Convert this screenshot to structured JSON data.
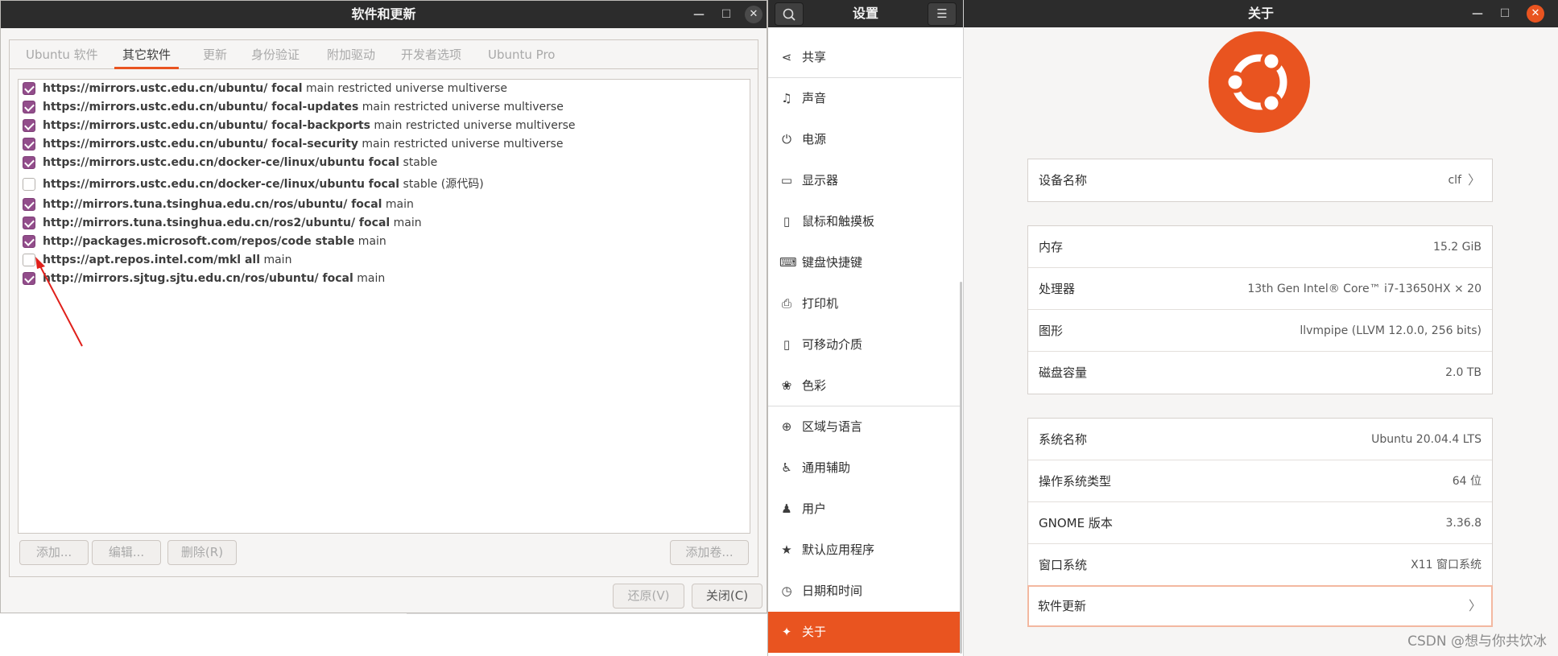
{
  "sw_window": {
    "title": "软件和更新",
    "minimize_icon": "—",
    "maximize_icon": "☐",
    "close_icon": "✕",
    "tabs": [
      "Ubuntu 软件",
      "其它软件",
      "更新",
      "身份验证",
      "附加驱动",
      "开发者选项",
      "Ubuntu Pro"
    ],
    "active_tab": "其它软件",
    "sources": [
      {
        "checked": true,
        "bold": "https://mirrors.ustc.edu.cn/ubuntu/ focal",
        "rest": " main restricted universe multiverse"
      },
      {
        "checked": true,
        "bold": "https://mirrors.ustc.edu.cn/ubuntu/ focal-updates",
        "rest": " main restricted universe multiverse"
      },
      {
        "checked": true,
        "bold": "https://mirrors.ustc.edu.cn/ubuntu/ focal-backports",
        "rest": " main restricted universe multiverse"
      },
      {
        "checked": true,
        "bold": "https://mirrors.ustc.edu.cn/ubuntu/ focal-security",
        "rest": " main restricted universe multiverse"
      },
      {
        "checked": true,
        "bold": "https://mirrors.ustc.edu.cn/docker-ce/linux/ubuntu focal",
        "rest": " stable"
      },
      {
        "checked": false,
        "bold": "https://mirrors.ustc.edu.cn/docker-ce/linux/ubuntu focal",
        "rest": " stable (源代码)"
      },
      {
        "checked": true,
        "bold": "http://mirrors.tuna.tsinghua.edu.cn/ros/ubuntu/ focal",
        "rest": " main"
      },
      {
        "checked": true,
        "bold": "http://mirrors.tuna.tsinghua.edu.cn/ros2/ubuntu/ focal",
        "rest": " main"
      },
      {
        "checked": true,
        "bold": "http://packages.microsoft.com/repos/code stable",
        "rest": " main"
      },
      {
        "checked": false,
        "bold": "https://apt.repos.intel.com/mkl all",
        "rest": " main"
      },
      {
        "checked": true,
        "bold": "http://mirrors.sjtug.sjtu.edu.cn/ros/ubuntu/ focal",
        "rest": " main"
      }
    ],
    "buttons": {
      "add": "添加...",
      "edit": "编辑...",
      "remove": "删除(R)",
      "add_volume": "添加卷..."
    },
    "footer": {
      "revert": "还原(V)",
      "close": "关闭(C)"
    }
  },
  "settings": {
    "title": "设置",
    "search_icon": "search-icon",
    "menu_icon": "☰",
    "items": [
      {
        "label": "共享",
        "icon": "share-icon",
        "glyph": "⋖"
      },
      {
        "label": "声音",
        "icon": "music-note-icon",
        "glyph": "♫"
      },
      {
        "label": "电源",
        "icon": "power-icon",
        "glyph": "⏻"
      },
      {
        "label": "显示器",
        "icon": "display-icon",
        "glyph": "▭"
      },
      {
        "label": "鼠标和触摸板",
        "icon": "mouse-icon",
        "glyph": "▯"
      },
      {
        "label": "键盘快捷键",
        "icon": "keyboard-icon",
        "glyph": "⌨"
      },
      {
        "label": "打印机",
        "icon": "printer-icon",
        "glyph": "⎙"
      },
      {
        "label": "可移动介质",
        "icon": "removable-media-icon",
        "glyph": "▯"
      },
      {
        "label": "色彩",
        "icon": "color-icon",
        "glyph": "❀"
      },
      {
        "label": "区域与语言",
        "icon": "globe-icon",
        "glyph": "⊕"
      },
      {
        "label": "通用辅助",
        "icon": "accessibility-icon",
        "glyph": "♿"
      },
      {
        "label": "用户",
        "icon": "users-icon",
        "glyph": "♟"
      },
      {
        "label": "默认应用程序",
        "icon": "star-icon",
        "glyph": "★"
      },
      {
        "label": "日期和时间",
        "icon": "clock-icon",
        "glyph": "◷"
      },
      {
        "label": "关于",
        "icon": "sparkle-icon",
        "glyph": "✦"
      }
    ]
  },
  "about": {
    "title": "关于",
    "minimize_icon": "—",
    "maximize_icon": "☐",
    "close_icon": "✕",
    "device_name_label": "设备名称",
    "device_name_value": "clf",
    "hardware": [
      {
        "k": "内存",
        "v": "15.2 GiB"
      },
      {
        "k": "处理器",
        "v": "13th Gen Intel® Core™ i7-13650HX × 20"
      },
      {
        "k": "图形",
        "v": "llvmpipe (LLVM 12.0.0, 256 bits)"
      },
      {
        "k": "磁盘容量",
        "v": "2.0 TB"
      }
    ],
    "system": [
      {
        "k": "系统名称",
        "v": "Ubuntu 20.04.4 LTS"
      },
      {
        "k": "操作系统类型",
        "v": "64 位"
      },
      {
        "k": "GNOME 版本",
        "v": "3.36.8"
      },
      {
        "k": "窗口系统",
        "v": "X11 窗口系统"
      }
    ],
    "software_updates_label": "软件更新",
    "chevron": "〉",
    "brand_color": "#e95420"
  },
  "watermark": "CSDN @想与你共饮冰"
}
